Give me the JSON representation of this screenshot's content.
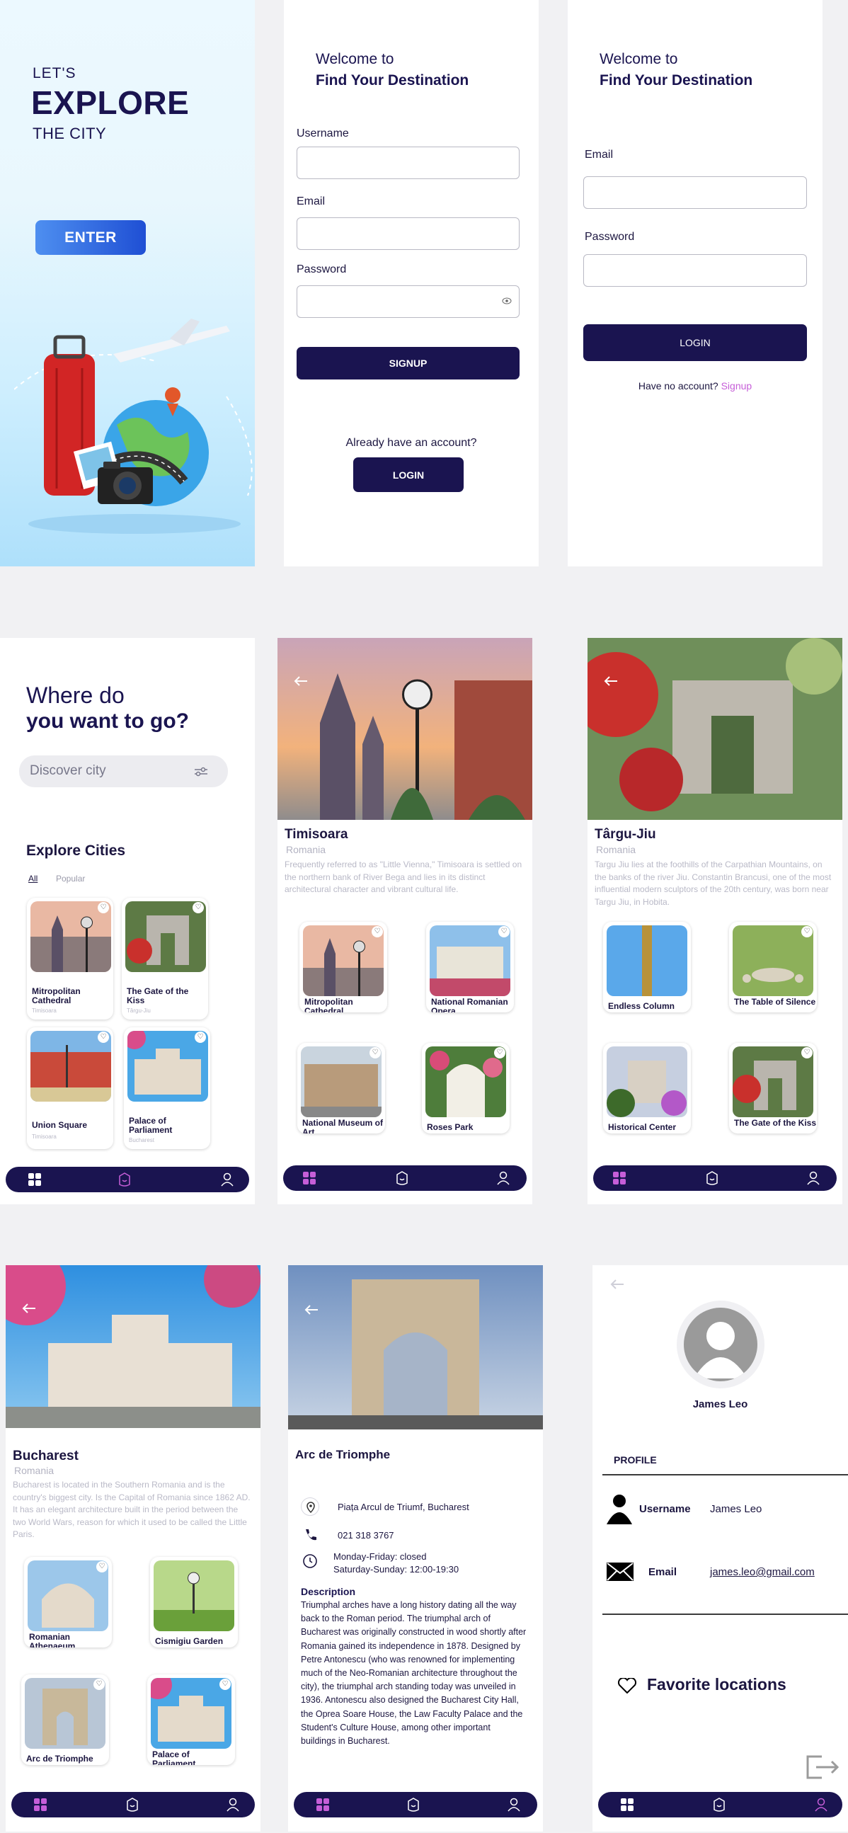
{
  "splash": {
    "lets": "LET'S",
    "explore": "EXPLORE",
    "the_city": "THE CITY",
    "enter_label": "ENTER"
  },
  "signup": {
    "welcome": "Welcome to",
    "headline": "Find Your Destination",
    "username_label": "Username",
    "email_label": "Email",
    "password_label": "Password",
    "signup_label": "SIGNUP",
    "already_text": "Already have an account?",
    "login_label": "LOGIN"
  },
  "login": {
    "welcome": "Welcome to",
    "headline": "Find Your Destination",
    "email_label": "Email",
    "password_label": "Password",
    "login_label": "LOGIN",
    "no_account_text": "Have no account?",
    "signup_link": "Signup"
  },
  "home": {
    "heading_line1": "Where do",
    "heading_line2": "you want to go?",
    "search_placeholder": "Discover city",
    "section_title": "Explore Cities",
    "tabs": [
      "All",
      "Popular"
    ],
    "cards": [
      {
        "title": "Mitropolitan Cathedral",
        "location": "Timisoara"
      },
      {
        "title": "The Gate of the Kiss",
        "location": "Târgu-Jiu"
      },
      {
        "title": "Union Square",
        "location": "Timisoara"
      },
      {
        "title": "Palace of Parliament",
        "location": "Bucharest"
      }
    ]
  },
  "timisoara": {
    "city": "Timisoara",
    "country": "Romania",
    "description": "Frequently referred to as \"Little Vienna,\" Timisoara is settled on the northern bank of River Bega and lies in its distinct architectural character and vibrant cultural life.",
    "cards": [
      {
        "title": "Mitropolitan Cathedral"
      },
      {
        "title": "National Romanian Opera"
      },
      {
        "title": "National Museum of Art"
      },
      {
        "title": "Roses Park"
      }
    ]
  },
  "targujiu": {
    "city": "Târgu-Jiu",
    "country": "Romania",
    "description": "Targu Jiu lies at the foothills of the Carpathian Mountains, on the banks of the river Jiu. Constantin Brancusi, one of the most influential modern sculptors of the 20th century, was born near Targu Jiu, in Hobita.",
    "cards": [
      {
        "title": "Endless Column"
      },
      {
        "title": "The Table of Silence"
      },
      {
        "title": "Historical Center"
      },
      {
        "title": "The Gate of the Kiss"
      }
    ]
  },
  "bucharest": {
    "city": "Bucharest",
    "country": "Romania",
    "description": "Bucharest is located in the Southern Romania and is the country's biggest city. Is the Capital of Romania since 1862 AD. It has an elegant architecture built in the period between the two World Wars, reason for which it used to be called the Little Paris.",
    "cards": [
      {
        "title": "Romanian Athenaeum"
      },
      {
        "title": "Cismigiu Garden"
      },
      {
        "title": "Arc de Triomphe"
      },
      {
        "title": "Palace of Parliament"
      }
    ]
  },
  "arc": {
    "title": "Arc de Triomphe",
    "address": "Piața Arcul de Triumf, Bucharest",
    "phone": "021 318 3767",
    "hours_line1": "Monday-Friday: closed",
    "hours_line2": "Saturday-Sunday: 12:00-19:30",
    "description_title": "Description",
    "description": "Triumphal arches have a long history dating all the way back to the Roman period. The triumphal arch of Bucharest was originally constructed in wood shortly after Romania gained its independence in 1878. Designed by Petre Antonescu (who was renowned for implementing much of the Neo-Romanian architecture throughout the city), the triumphal arch standing today was unveiled in 1936. Antonescu also designed the Bucharest City Hall, the Oprea Soare House, the Law Faculty Palace and the Student's Culture House, among other important buildings in Bucharest."
  },
  "profile": {
    "name": "James Leo",
    "section_title": "PROFILE",
    "username_label": "Username",
    "username_value": "James Leo",
    "email_label": "Email",
    "email_value": "james.leo@gmail.com",
    "favorites_label": "Favorite locations"
  },
  "colors": {
    "navy": "#1a1450",
    "accent_pink": "#c65ed8",
    "enter_blue": "#2f63e0"
  }
}
